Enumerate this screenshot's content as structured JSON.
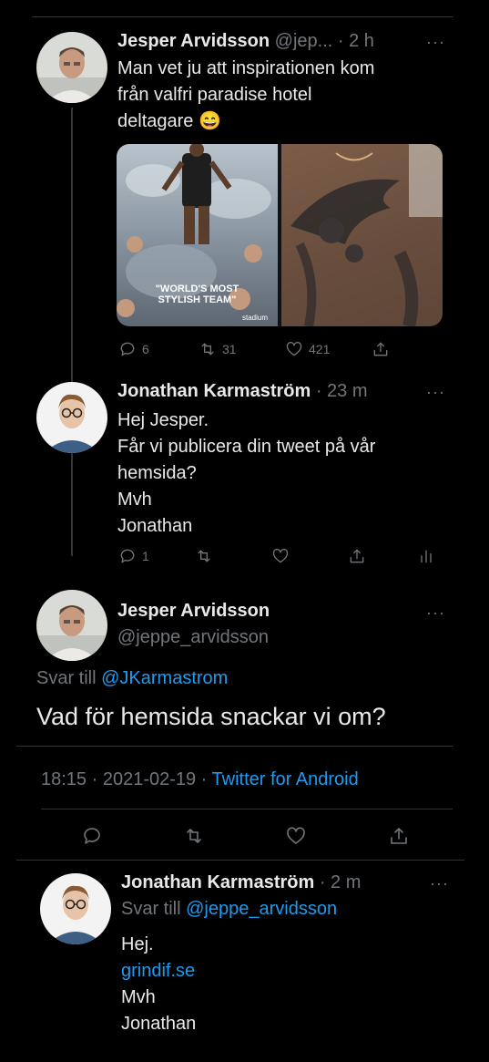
{
  "tweet1": {
    "author_name": "Jesper Arvidsson",
    "handle_truncated": "@jep...",
    "time": "· 2 h",
    "more": "···",
    "text_lines": [
      "Man vet ju att inspirationen kom",
      "från valfri paradise hotel",
      "deltagare 😄"
    ],
    "image_left_caption_1": "\"WORLD'S MOST",
    "image_left_caption_2": "STYLISH TEAM\"",
    "image_left_brand": "stadium",
    "replies": "6",
    "retweets": "31",
    "likes": "421"
  },
  "tweet2": {
    "author_name": "Jonathan Karmaström",
    "time": "· 23 m",
    "more": "···",
    "text_lines": [
      "Hej Jesper.",
      "Får vi publicera din tweet på vår",
      "hemsida?",
      "Mvh",
      "Jonathan"
    ],
    "replies": "1"
  },
  "main_tweet": {
    "author_name": "Jesper Arvidsson",
    "handle": "@jeppe_arvidsson",
    "more": "···",
    "reply_prefix": "Svar till ",
    "reply_to": "@JKarmastrom",
    "text": "Vad för hemsida snackar vi om?",
    "timestamp": "18:15 · 2021-02-19 · ",
    "source": "Twitter for Android"
  },
  "tweet3": {
    "author_name": "Jonathan Karmaström",
    "time": "· 2 m",
    "more": "···",
    "reply_prefix": "Svar till ",
    "reply_to": "@jeppe_arvidsson",
    "line1": "Hej.",
    "link": "grindif.se",
    "line3": "Mvh",
    "line4": "Jonathan"
  },
  "colors": {
    "background": "#000000",
    "text": "#e7e9ea",
    "muted": "#71767b",
    "link": "#1d9bf0",
    "divider": "#2f3336"
  }
}
